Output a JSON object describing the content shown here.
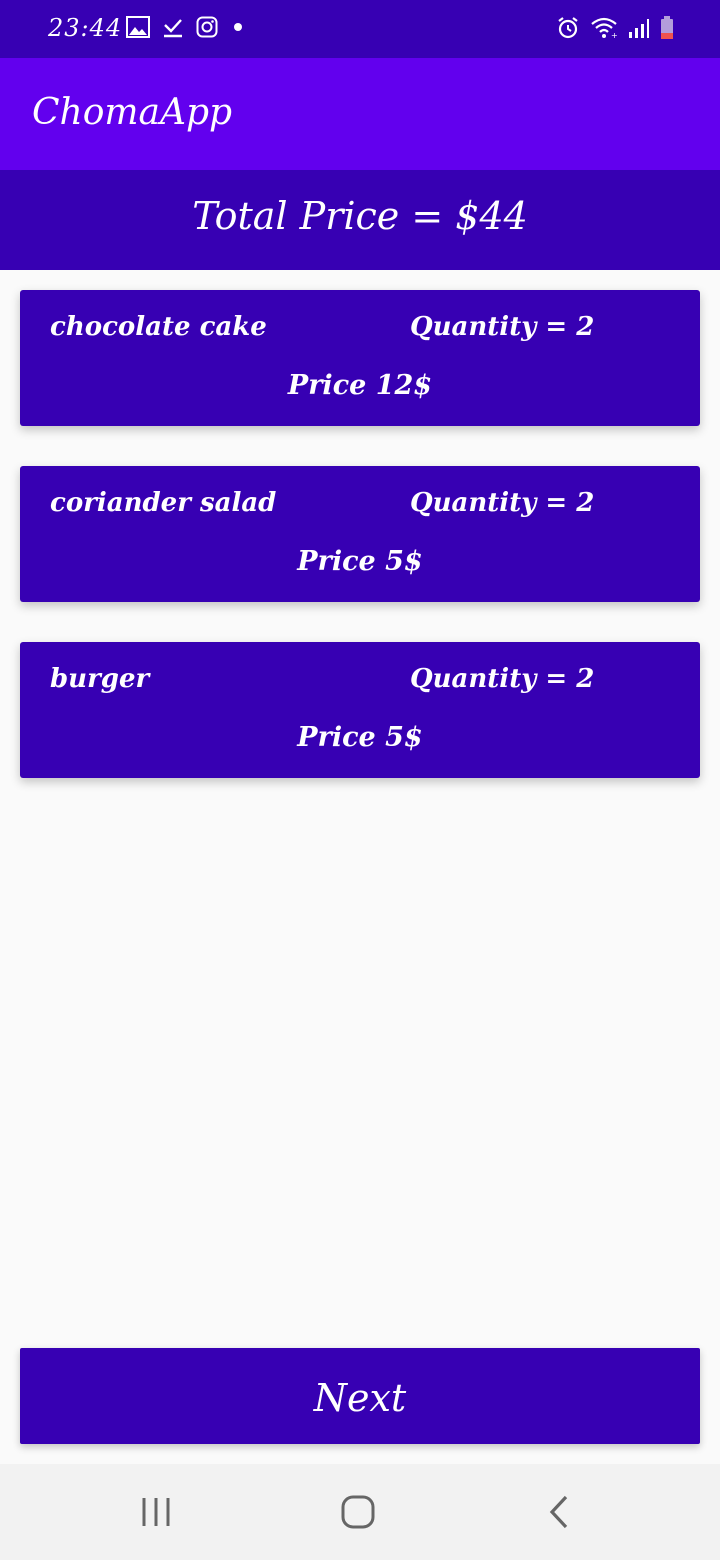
{
  "status_bar": {
    "time": "23:44",
    "left_icons": [
      "gallery-icon",
      "download-done-icon",
      "instagram-icon",
      "dot-icon"
    ],
    "right_icons": [
      "alarm-icon",
      "wifi-icon",
      "signal-icon",
      "battery-icon"
    ],
    "background": "#3700b3"
  },
  "app_bar": {
    "title": "ChomaApp",
    "background": "#6200ee"
  },
  "summary": {
    "total_label": "Total Price = $44"
  },
  "cart": {
    "items": [
      {
        "name": "chocolate cake",
        "quantity": "Quantity = 2",
        "price": "Price 12$"
      },
      {
        "name": "coriander salad",
        "quantity": "Quantity = 2",
        "price": "Price 5$"
      },
      {
        "name": "burger",
        "quantity": "Quantity = 2",
        "price": "Price 5$"
      }
    ],
    "card_color": "#3700b3"
  },
  "actions": {
    "next_label": "Next"
  },
  "nav_bar": {
    "buttons": [
      "recent-apps-icon",
      "home-icon",
      "back-icon"
    ]
  }
}
